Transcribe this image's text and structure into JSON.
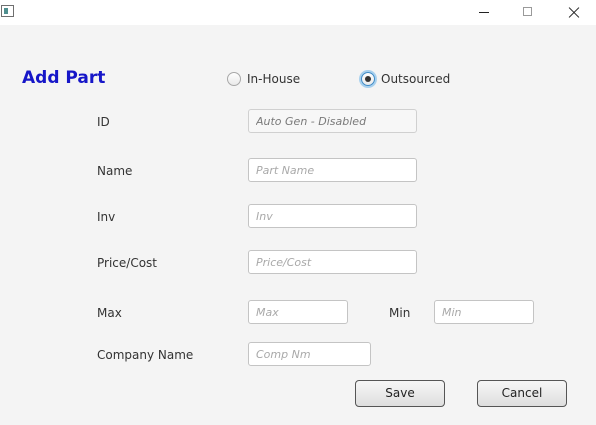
{
  "window": {
    "icon": "app-window-icon",
    "controls": [
      "minimize-icon",
      "maximize-icon",
      "close-icon"
    ]
  },
  "form": {
    "title": "Add Part",
    "source_options": [
      {
        "label": "In-House",
        "selected": false
      },
      {
        "label": "Outsourced",
        "selected": true
      }
    ],
    "fields": {
      "id": {
        "label": "ID",
        "placeholder": "Auto Gen - Disabled",
        "value": "",
        "disabled": true
      },
      "name": {
        "label": "Name",
        "placeholder": "Part Name",
        "value": ""
      },
      "inv": {
        "label": "Inv",
        "placeholder": "Inv",
        "value": ""
      },
      "price": {
        "label": "Price/Cost",
        "placeholder": "Price/Cost",
        "value": ""
      },
      "max": {
        "label": "Max",
        "placeholder": "Max",
        "value": ""
      },
      "min": {
        "label": "Min",
        "placeholder": "Min",
        "value": ""
      },
      "company": {
        "label": "Company Name",
        "placeholder": "Comp Nm",
        "value": ""
      }
    },
    "buttons": {
      "save": "Save",
      "cancel": "Cancel"
    }
  },
  "colors": {
    "title": "#1616c8",
    "background": "#f4f4f4",
    "radio_focus": "#3c8ac7"
  }
}
